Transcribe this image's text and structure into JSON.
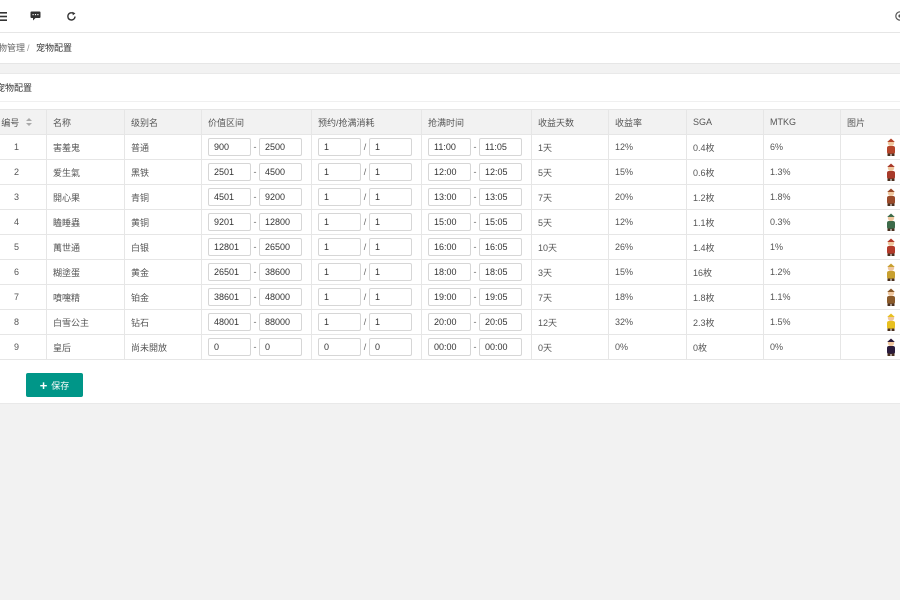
{
  "breadcrumb": {
    "parent": "物管理",
    "separator": "/",
    "current": "宠物配置"
  },
  "card": {
    "title": "宠物配置"
  },
  "table": {
    "headers": {
      "id": "编号",
      "name": "名称",
      "level": "级别名",
      "price": "价值区间",
      "cost": "预约/抢满消耗",
      "time": "抢满时间",
      "days": "收益天数",
      "rate": "收益率",
      "sga": "SGA",
      "mtkg": "MTKG",
      "image": "图片"
    },
    "rows": [
      {
        "id": "1",
        "name": "害羞鬼",
        "level": "普通",
        "price_min": "900",
        "price_max": "2500",
        "cost_a": "1",
        "cost_b": "1",
        "time_start": "11:00",
        "time_end": "11:05",
        "days": "1天",
        "rate": "12%",
        "sga": "0.4枚",
        "mtkg": "6%",
        "pet_color": "#b5442a"
      },
      {
        "id": "2",
        "name": "爱生氣",
        "level": "黑铁",
        "price_min": "2501",
        "price_max": "4500",
        "cost_a": "1",
        "cost_b": "1",
        "time_start": "12:00",
        "time_end": "12:05",
        "days": "5天",
        "rate": "15%",
        "sga": "0.6枚",
        "mtkg": "1.3%",
        "pet_color": "#a83a2a"
      },
      {
        "id": "3",
        "name": "開心果",
        "level": "青铜",
        "price_min": "4501",
        "price_max": "9200",
        "cost_a": "1",
        "cost_b": "1",
        "time_start": "13:00",
        "time_end": "13:05",
        "days": "7天",
        "rate": "20%",
        "sga": "1.2枚",
        "mtkg": "1.8%",
        "pet_color": "#9a4a2a"
      },
      {
        "id": "4",
        "name": "瞌睡蟲",
        "level": "黄铜",
        "price_min": "9201",
        "price_max": "12800",
        "cost_a": "1",
        "cost_b": "1",
        "time_start": "15:00",
        "time_end": "15:05",
        "days": "5天",
        "rate": "12%",
        "sga": "1.1枚",
        "mtkg": "0.3%",
        "pet_color": "#3d6b4a"
      },
      {
        "id": "5",
        "name": "萬世通",
        "level": "白银",
        "price_min": "12801",
        "price_max": "26500",
        "cost_a": "1",
        "cost_b": "1",
        "time_start": "16:00",
        "time_end": "16:05",
        "days": "10天",
        "rate": "26%",
        "sga": "1.4枚",
        "mtkg": "1%",
        "pet_color": "#b33a2a"
      },
      {
        "id": "6",
        "name": "糊塗蛋",
        "level": "黄金",
        "price_min": "26501",
        "price_max": "38600",
        "cost_a": "1",
        "cost_b": "1",
        "time_start": "18:00",
        "time_end": "18:05",
        "days": "3天",
        "rate": "15%",
        "sga": "16枚",
        "mtkg": "1.2%",
        "pet_color": "#c8a030"
      },
      {
        "id": "7",
        "name": "噴嚏精",
        "level": "铂金",
        "price_min": "38601",
        "price_max": "48000",
        "cost_a": "1",
        "cost_b": "1",
        "time_start": "19:00",
        "time_end": "19:05",
        "days": "7天",
        "rate": "18%",
        "sga": "1.8枚",
        "mtkg": "1.1%",
        "pet_color": "#8a5a2a"
      },
      {
        "id": "8",
        "name": "白雪公主",
        "level": "钻石",
        "price_min": "48001",
        "price_max": "88000",
        "cost_a": "1",
        "cost_b": "1",
        "time_start": "20:00",
        "time_end": "20:05",
        "days": "12天",
        "rate": "32%",
        "sga": "2.3枚",
        "mtkg": "1.5%",
        "pet_color": "#e8c020"
      },
      {
        "id": "9",
        "name": "皇后",
        "level": "尚未開放",
        "price_min": "0",
        "price_max": "0",
        "cost_a": "0",
        "cost_b": "0",
        "time_start": "00:00",
        "time_end": "00:00",
        "days": "0天",
        "rate": "0%",
        "sga": "0枚",
        "mtkg": "0%",
        "pet_color": "#2a1a3a"
      }
    ],
    "range_sep": "-",
    "cost_sep": "/"
  },
  "save_button": {
    "label": "保存",
    "color": "#009688"
  }
}
